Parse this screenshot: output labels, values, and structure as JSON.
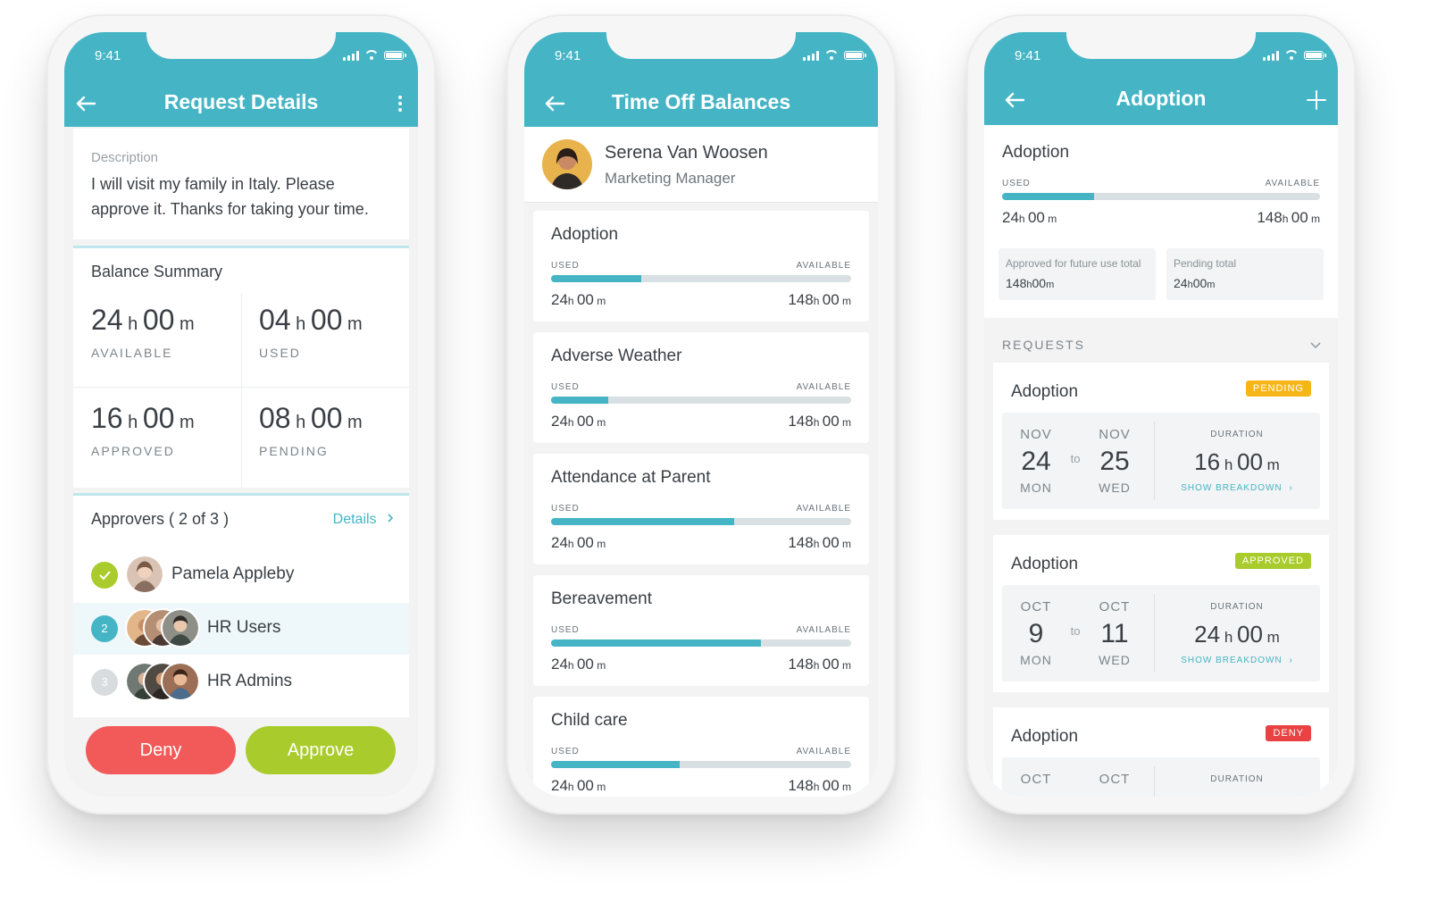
{
  "status_time": "9:41",
  "colors": {
    "accent": "#45b5c6",
    "deny": "#f25a5a",
    "approve": "#a9cc2c",
    "pending": "#f7b617",
    "approved": "#a9cc2c",
    "deny_badge": "#ea4242"
  },
  "phone1": {
    "title": "Request Details",
    "description_label": "Description",
    "description_line1": "I will visit my family in Italy. Please",
    "description_line2": "approve it. Thanks for taking your time.",
    "balance_title": "Balance Summary",
    "h": "h",
    "m": "m",
    "balances": [
      {
        "hours": "24",
        "mins": "00",
        "label": "AVAILABLE"
      },
      {
        "hours": "04",
        "mins": "00",
        "label": "USED"
      },
      {
        "hours": "16",
        "mins": "00",
        "label": "APPROVED"
      },
      {
        "hours": "08",
        "mins": "00",
        "label": "PENDING"
      }
    ],
    "approvers_title": "Approvers ( 2 of 3 )",
    "details_link": "Details",
    "approvers": [
      {
        "step": "",
        "name": "Pamela Appleby",
        "status": "done"
      },
      {
        "step": "2",
        "name": "HR Users",
        "status": "current"
      },
      {
        "step": "3",
        "name": "HR Admins",
        "status": "upcoming"
      }
    ],
    "deny_label": "Deny",
    "approve_label": "Approve"
  },
  "phone2": {
    "title": "Time Off Balances",
    "user_name": "Serena Van Woosen",
    "user_role": "Marketing Manager",
    "used_label": "USED",
    "available_label": "AVAILABLE",
    "h": "h",
    "m": "m",
    "items": [
      {
        "name": "Adoption",
        "used_h": "24",
        "used_m": "00",
        "avail_h": "148",
        "avail_m": "00",
        "fraction": 0.3
      },
      {
        "name": "Adverse Weather",
        "used_h": "24",
        "used_m": "00",
        "avail_h": "148",
        "avail_m": "00",
        "fraction": 0.19
      },
      {
        "name": "Attendance at Parent",
        "used_h": "24",
        "used_m": "00",
        "avail_h": "148",
        "avail_m": "00",
        "fraction": 0.61
      },
      {
        "name": "Bereavement",
        "used_h": "24",
        "used_m": "00",
        "avail_h": "148",
        "avail_m": "00",
        "fraction": 0.7
      },
      {
        "name": "Child care",
        "used_h": "24",
        "used_m": "00",
        "avail_h": "148",
        "avail_m": "00",
        "fraction": 0.43
      }
    ]
  },
  "phone3": {
    "title": "Adoption",
    "summary_title": "Adoption",
    "used_label": "USED",
    "available_label": "AVAILABLE",
    "used_h": "24",
    "used_m": "00",
    "avail_h": "148",
    "avail_m": "00",
    "used_fraction": 0.29,
    "h": "h",
    "m": "m",
    "approved_future_label": "Approved for future use total",
    "approved_future_value_h": "148",
    "approved_future_value_m": "00",
    "pending_total_label": "Pending total",
    "pending_total_value_h": "24",
    "pending_total_value_m": "00",
    "requests_label": "REQUESTS",
    "to_label": "to",
    "duration_label": "DURATION",
    "breakdown_label": "SHOW BREAKDOWN",
    "requests": [
      {
        "name": "Adoption",
        "status": "PENDING",
        "from_month": "NOV",
        "from_day": "24",
        "from_dow": "MON",
        "to_month": "NOV",
        "to_day": "25",
        "to_dow": "WED",
        "dur_h": "16",
        "dur_m": "00"
      },
      {
        "name": "Adoption",
        "status": "APPROVED",
        "from_month": "OCT",
        "from_day": "9",
        "from_dow": "MON",
        "to_month": "OCT",
        "to_day": "11",
        "to_dow": "WED",
        "dur_h": "24",
        "dur_m": "00"
      },
      {
        "name": "Adoption",
        "status": "DENY",
        "from_month": "OCT",
        "to_month": "OCT"
      }
    ]
  }
}
